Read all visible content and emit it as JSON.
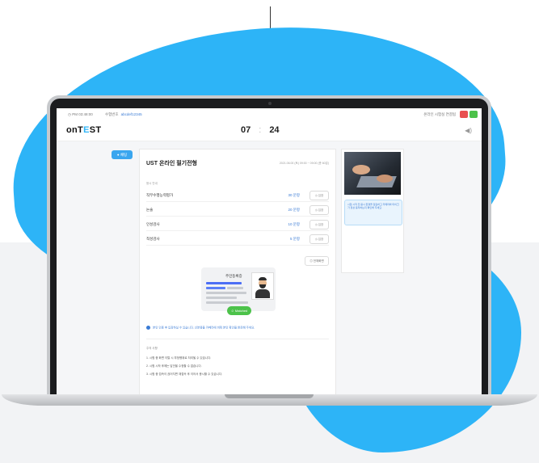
{
  "app": {
    "logo": "onTEST",
    "status_bar": {
      "time": "PM 03:48:00",
      "user_label": "수험번호",
      "user_id": "abcdef12345",
      "status_text": "온라인 시험실 연결됨"
    },
    "timer": {
      "minutes": "07",
      "seconds": "24",
      "separator": ":"
    },
    "chat_button": "채팅",
    "exam": {
      "title": "UST 온라인 필기전형",
      "date": "2021.06.00 (토) 09:00 ~ 09:00 (총 60분)",
      "section_label": "응시 안내",
      "subjects": [
        {
          "name": "직무수행능력평가",
          "time": "30 문항",
          "button": "입장"
        },
        {
          "name": "논술",
          "time": "20 문항",
          "button": "입장"
        },
        {
          "name": "인성검사",
          "time": "10 문항",
          "button": "입장"
        },
        {
          "name": "적성검사",
          "time": "5 문항",
          "button": "입장"
        }
      ],
      "fullscreen_button": "전체화면",
      "id_card": {
        "title": "주민등록증",
        "match_label": "Matched"
      },
      "info_text": "본인 인증 후 입장하실 수 있습니다. 신분증을 카메라에 비춰 본인 확인을 완료해 주세요.",
      "notes_header": "주의 사항",
      "notes": [
        {
          "num": "1.",
          "text": "시험 중 화면 이탈 시 부정행위로 처리될 수 있습니다.",
          "highlight": "부정행위"
        },
        {
          "num": "2.",
          "text": "시험 시작 후에는 답안을 수정할 수 없습니다.",
          "highlight": "수정"
        },
        {
          "num": "3.",
          "text": "시험 중 접속이 끊어지면 재접속 후 이어서 응시할 수 있습니다.",
          "highlight": "재접속"
        }
      ]
    },
    "side_notice": "시험 시작 전 응시 환경을 점검하고 카메라와 마이크가 정상 동작하는지 확인해 주세요."
  },
  "colors": {
    "accent": "#2db4f7",
    "primary_blue": "#3a7bd5",
    "success": "#4cc24a",
    "danger": "#e04646"
  }
}
